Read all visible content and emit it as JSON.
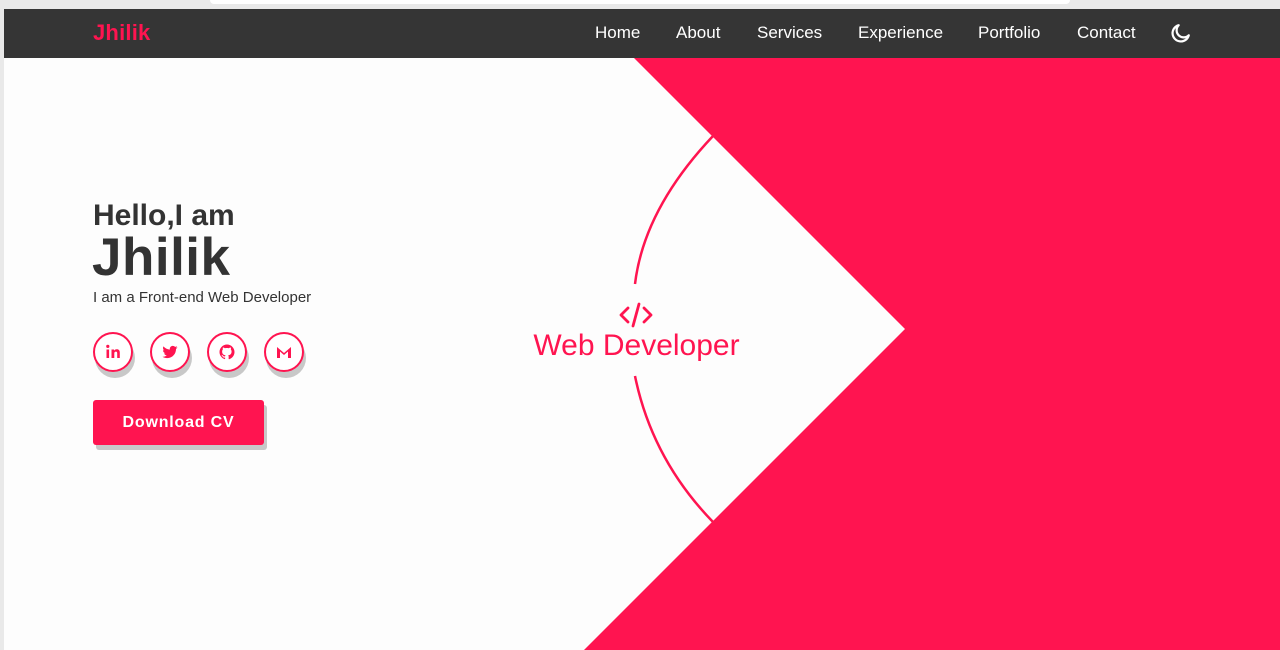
{
  "brand": {
    "logo": "Jhilik"
  },
  "nav": {
    "links": [
      "Home",
      "About",
      "Services",
      "Experience",
      "Portfolio",
      "Contact"
    ],
    "theme_toggle_icon": "moon-icon"
  },
  "hero": {
    "greeting": "Hello,I am",
    "name": "Jhilik",
    "tagline": "I am a Front-end Web Developer",
    "social_icons": [
      "linkedin-icon",
      "twitter-icon",
      "github-icon",
      "gmail-icon"
    ],
    "cta_label": "Download CV",
    "role_icon": "code-icon",
    "role_label": "Web Developer"
  },
  "colors": {
    "accent": "#ff1450",
    "navbar": "#353535",
    "text": "#333333",
    "background": "#fdfdfd"
  }
}
